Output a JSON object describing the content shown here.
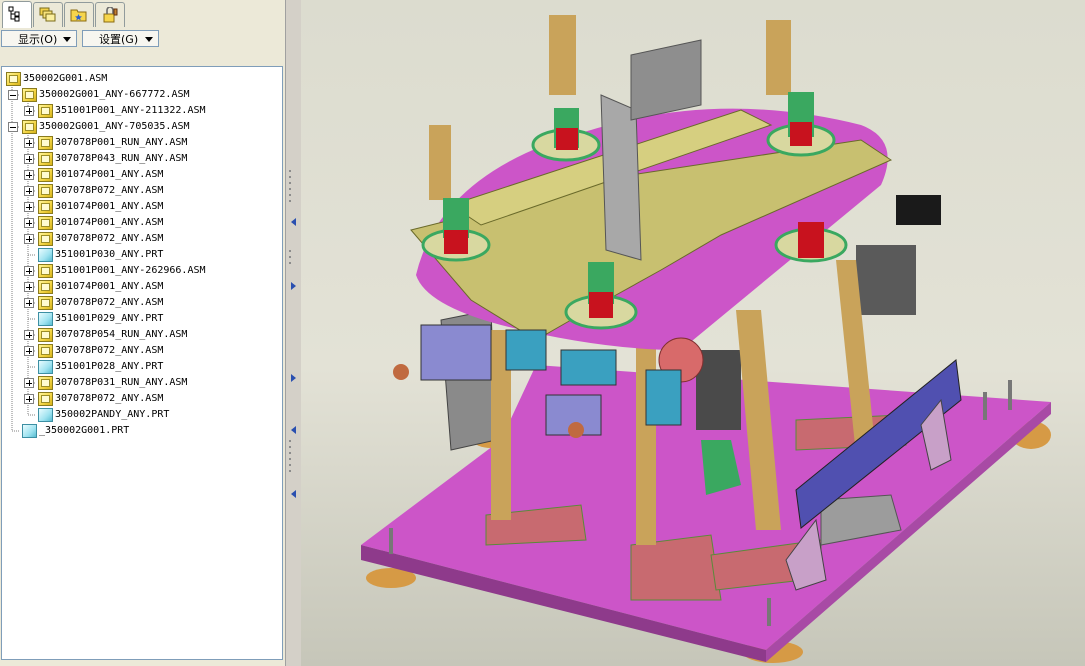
{
  "tabs": [
    {
      "icon": "model-tree-icon",
      "active": true
    },
    {
      "icon": "layers-icon",
      "active": false
    },
    {
      "icon": "favorites-folder-icon",
      "active": false
    },
    {
      "icon": "connections-icon",
      "active": false
    }
  ],
  "toolbar": {
    "show_label": "显示(O)",
    "settings_label": "设置(G)"
  },
  "tree": [
    {
      "level": 0,
      "type": "asm",
      "label": "350002G001.ASM",
      "expander": "none"
    },
    {
      "level": 1,
      "type": "asm",
      "label": "350002G001_ANY-667772.ASM",
      "expander": "minus"
    },
    {
      "level": 2,
      "type": "asm",
      "label": "351001P001_ANY-211322.ASM",
      "expander": "plus"
    },
    {
      "level": 1,
      "type": "asm",
      "label": "350002G001_ANY-705035.ASM",
      "expander": "minus"
    },
    {
      "level": 2,
      "type": "asm",
      "label": "307078P001_RUN_ANY.ASM",
      "expander": "plus"
    },
    {
      "level": 2,
      "type": "asm",
      "label": "307078P043_RUN_ANY.ASM",
      "expander": "plus"
    },
    {
      "level": 2,
      "type": "asm",
      "label": "301074P001_ANY.ASM",
      "expander": "plus"
    },
    {
      "level": 2,
      "type": "asm",
      "label": "307078P072_ANY.ASM",
      "expander": "plus"
    },
    {
      "level": 2,
      "type": "asm",
      "label": "301074P001_ANY.ASM",
      "expander": "plus"
    },
    {
      "level": 2,
      "type": "asm",
      "label": "301074P001_ANY.ASM",
      "expander": "plus"
    },
    {
      "level": 2,
      "type": "asm",
      "label": "307078P072_ANY.ASM",
      "expander": "plus"
    },
    {
      "level": 2,
      "type": "prt",
      "label": "351001P030_ANY.PRT",
      "expander": "none"
    },
    {
      "level": 2,
      "type": "asm",
      "label": "351001P001_ANY-262966.ASM",
      "expander": "plus"
    },
    {
      "level": 2,
      "type": "asm",
      "label": "301074P001_ANY.ASM",
      "expander": "plus"
    },
    {
      "level": 2,
      "type": "asm",
      "label": "307078P072_ANY.ASM",
      "expander": "plus"
    },
    {
      "level": 2,
      "type": "prt",
      "label": "351001P029_ANY.PRT",
      "expander": "none"
    },
    {
      "level": 2,
      "type": "asm",
      "label": "307078P054_RUN_ANY.ASM",
      "expander": "plus"
    },
    {
      "level": 2,
      "type": "asm",
      "label": "307078P072_ANY.ASM",
      "expander": "plus"
    },
    {
      "level": 2,
      "type": "prt",
      "label": "351001P028_ANY.PRT",
      "expander": "none"
    },
    {
      "level": 2,
      "type": "asm",
      "label": "307078P031_RUN_ANY.ASM",
      "expander": "plus"
    },
    {
      "level": 2,
      "type": "asm",
      "label": "307078P072_ANY.ASM",
      "expander": "plus"
    },
    {
      "level": 2,
      "type": "prt",
      "label": "350002PANDY_ANY.PRT",
      "expander": "none"
    },
    {
      "level": 1,
      "type": "prt",
      "label": "_350002G001.PRT",
      "expander": "none"
    }
  ],
  "colors": {
    "plate_magenta": "#cc55c8",
    "frame_olive": "#c8c070",
    "post_tan": "#c9a35a",
    "motor_green": "#3aa860",
    "chuck_red": "#c8121e",
    "panel_blue": "#5050b0",
    "pad_orange": "#d69a45",
    "tree_asm": "#f2d341",
    "tree_prt": "#9fe3f0"
  }
}
